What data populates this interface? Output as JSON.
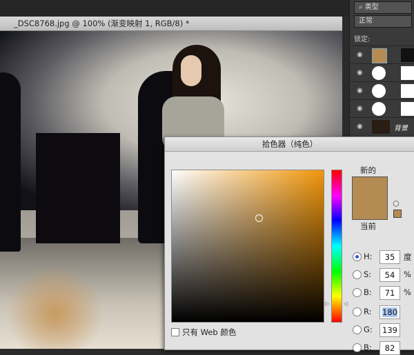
{
  "document": {
    "tab_title": "_DSC8768.jpg @ 100% (渐变映射 1, RGB/8) *"
  },
  "layers_panel": {
    "filter_label": "⌕ 类型",
    "blend_mode": "正常",
    "lock_label": "锁定:",
    "layers": [
      {
        "name": ""
      },
      {
        "name": ""
      },
      {
        "name": ""
      },
      {
        "name": ""
      },
      {
        "name": "背景"
      }
    ]
  },
  "color_picker": {
    "title": "拾色器（纯色）",
    "new_label": "新的",
    "current_label": "当前",
    "swatch_color": "#b48b52",
    "web_only_label": "只有 Web 颜色",
    "fields": [
      {
        "label": "H:",
        "value": "35",
        "unit": "度",
        "selected": true
      },
      {
        "label": "S:",
        "value": "54",
        "unit": "%",
        "selected": false
      },
      {
        "label": "B:",
        "value": "71",
        "unit": "%",
        "selected": false
      },
      {
        "label": "R:",
        "value": "180",
        "unit": "",
        "selected": false
      },
      {
        "label": "G:",
        "value": "139",
        "unit": "",
        "selected": false
      },
      {
        "label": "B:",
        "value": "82",
        "unit": "",
        "selected": false
      }
    ]
  }
}
